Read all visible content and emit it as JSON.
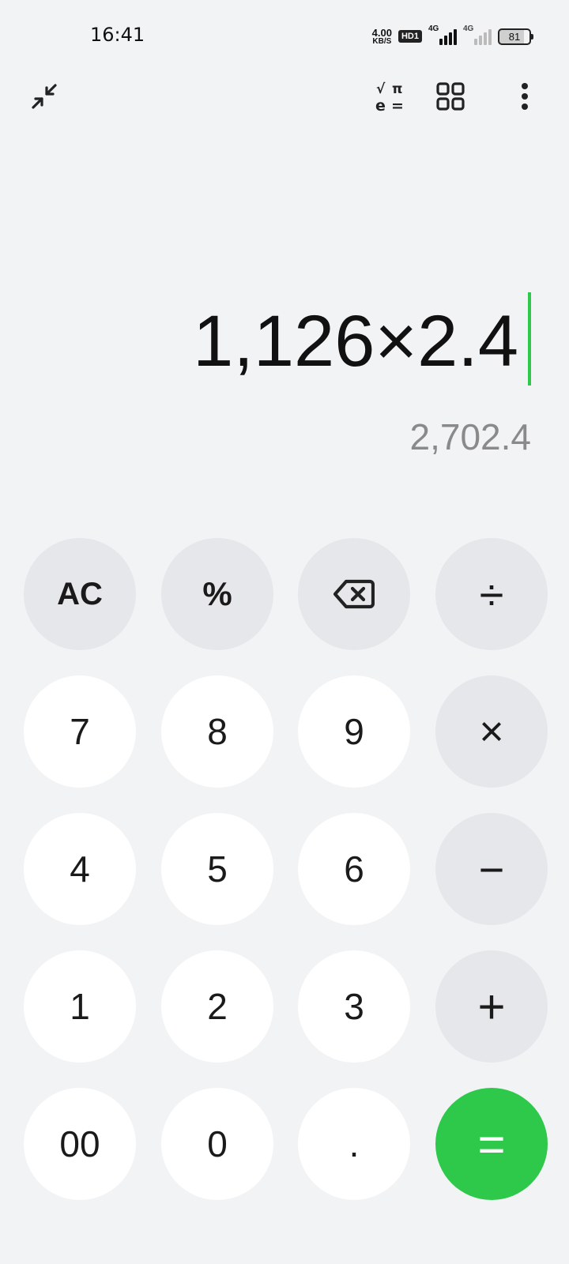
{
  "status_bar": {
    "time": "16:41",
    "net_speed_value": "4.00",
    "net_speed_unit": "KB/S",
    "hd_badge": "HD1",
    "sim1_label": "4G",
    "sim2_label": "4G",
    "battery": "81"
  },
  "toolbar": {
    "collapse_icon": "collapse-arrows-icon",
    "scientific_icon": "scientific-functions-icon",
    "scientific_sqrt": "√",
    "scientific_pi": "π",
    "scientific_e": "e",
    "scientific_eq": "=",
    "converter_icon": "grid-icon",
    "more_icon": "more-vertical-icon"
  },
  "display": {
    "expression": "1,126×2.4",
    "result": "2,702.4",
    "cursor_color": "#2ec84a"
  },
  "keypad": {
    "clear": "AC",
    "percent": "%",
    "backspace_icon": "backspace-icon",
    "divide": "÷",
    "multiply": "×",
    "minus": "−",
    "plus": "+",
    "equals": "=",
    "digit_7": "7",
    "digit_8": "8",
    "digit_9": "9",
    "digit_4": "4",
    "digit_5": "5",
    "digit_6": "6",
    "digit_1": "1",
    "digit_2": "2",
    "digit_3": "3",
    "double_zero": "00",
    "digit_0": "0",
    "decimal": ".",
    "equals_color": "#2ec84a"
  }
}
